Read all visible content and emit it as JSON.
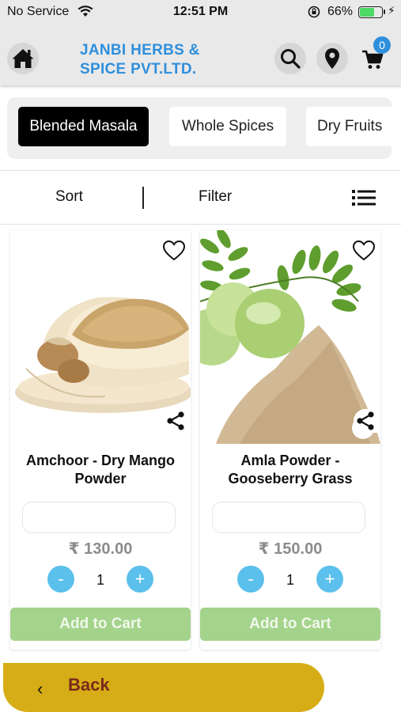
{
  "status_bar": {
    "carrier": "No Service",
    "time": "12:51 PM",
    "battery_percent": "66%",
    "battery_level": 0.66,
    "icons": [
      "wifi-icon",
      "orientation-lock-icon",
      "battery-icon",
      "charging-bolt-icon"
    ]
  },
  "header": {
    "brand_line1": "JANBI HERBS &",
    "brand_line2": "SPICE PVT.LTD.",
    "cart_count": "0",
    "brand_color": "#2f8fdc",
    "icons": [
      "home-icon",
      "search-icon",
      "location-pin-icon",
      "cart-icon"
    ]
  },
  "categories": [
    {
      "label": "Blended Masala",
      "active": true
    },
    {
      "label": "Whole Spices",
      "active": false
    },
    {
      "label": "Dry Fruits",
      "active": false
    }
  ],
  "toolbar": {
    "sort_label": "Sort",
    "filter_label": "Filter",
    "view_icon": "list-view-icon"
  },
  "products": [
    {
      "name_line1": "Amchoor - Dry Mango",
      "name_line2": "Powder",
      "price": "₹ 130.00",
      "quantity": "1",
      "minus_label": "-",
      "plus_label": "+",
      "add_to_cart_label": "Add to Cart"
    },
    {
      "name_line1": "Amla Powder -",
      "name_line2": "Gooseberry Grass",
      "price": "₹ 150.00",
      "quantity": "1",
      "minus_label": "-",
      "plus_label": "+",
      "add_to_cart_label": "Add to Cart"
    }
  ],
  "footer": {
    "back_label": "Back",
    "back_chevron": "‹"
  },
  "colors": {
    "accent_blue": "#5bc0eb",
    "add_to_cart_green": "#a4d38c",
    "back_bar_gold": "#d6ad16",
    "back_text": "#7a2a1c"
  }
}
